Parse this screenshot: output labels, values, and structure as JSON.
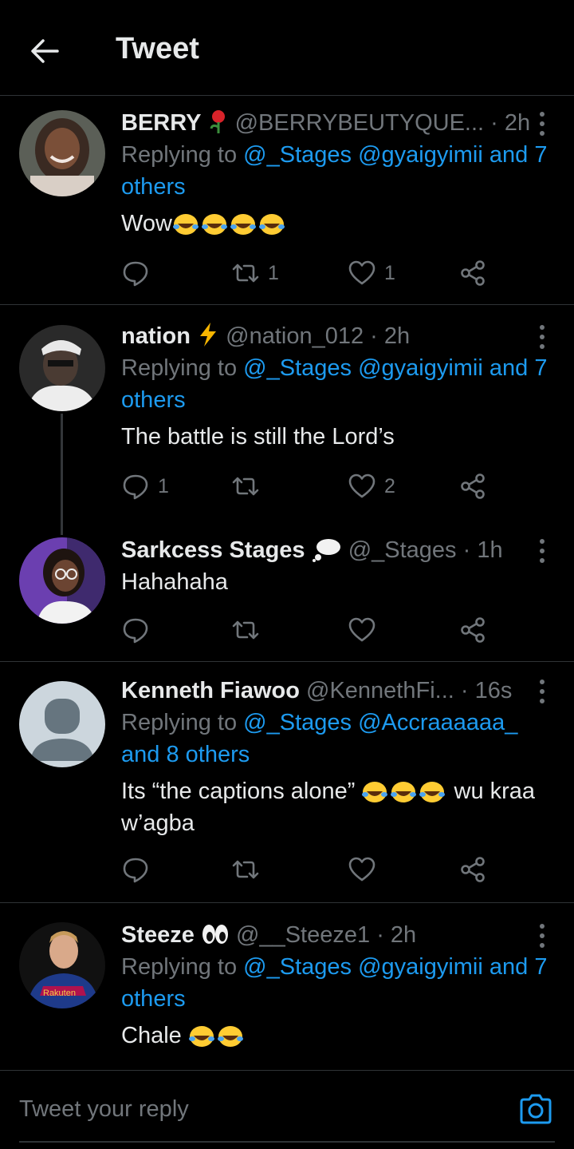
{
  "header": {
    "title": "Tweet"
  },
  "tweets": [
    {
      "name": "BERRY",
      "handle": "@BERRYBEUTYQUE...",
      "time": "· 2h",
      "replying_prefix": "Replying to",
      "replying_to": "@_Stages @gyaigyimii and 7 others",
      "text": "Wow",
      "emoji_count": 4,
      "reply_count": "",
      "retweet_count": "1",
      "like_count": "1"
    },
    {
      "name": "nation",
      "handle": "@nation_012",
      "time": "· 2h",
      "replying_prefix": "Replying to",
      "replying_to": "@_Stages @gyaigyimii and 7 others",
      "text": "The battle is still the Lord’s",
      "reply_count": "1",
      "retweet_count": "",
      "like_count": "2"
    },
    {
      "name": "Sarkcess Stages",
      "handle": "@_Stages",
      "time": "· 1h",
      "text": "Hahahaha",
      "reply_count": "",
      "retweet_count": "",
      "like_count": ""
    },
    {
      "name": "Kenneth Fiawoo",
      "handle": "@KennethFi...",
      "time": "· 16s",
      "replying_prefix": "Replying to",
      "replying_to": "@_Stages @Accraaaaaa_ and 8 others",
      "text_before": "Its “the captions alone”",
      "text_after": "wu kraa w’agba",
      "reply_count": "",
      "retweet_count": "",
      "like_count": ""
    },
    {
      "name": "Steeze",
      "handle": "@__Steeze1",
      "time": "· 2h",
      "replying_prefix": "Replying to",
      "replying_to": "@_Stages @gyaigyimii and 7 others",
      "text": "Chale"
    }
  ],
  "avatar_text": {
    "steeze_shirt": "Rakuten"
  },
  "compose": {
    "placeholder": "Tweet your reply"
  },
  "colors": {
    "background": "#000000",
    "text": "#e7e9ea",
    "muted": "#71767b",
    "link": "#1d9bf0",
    "divider": "#2f3336"
  }
}
